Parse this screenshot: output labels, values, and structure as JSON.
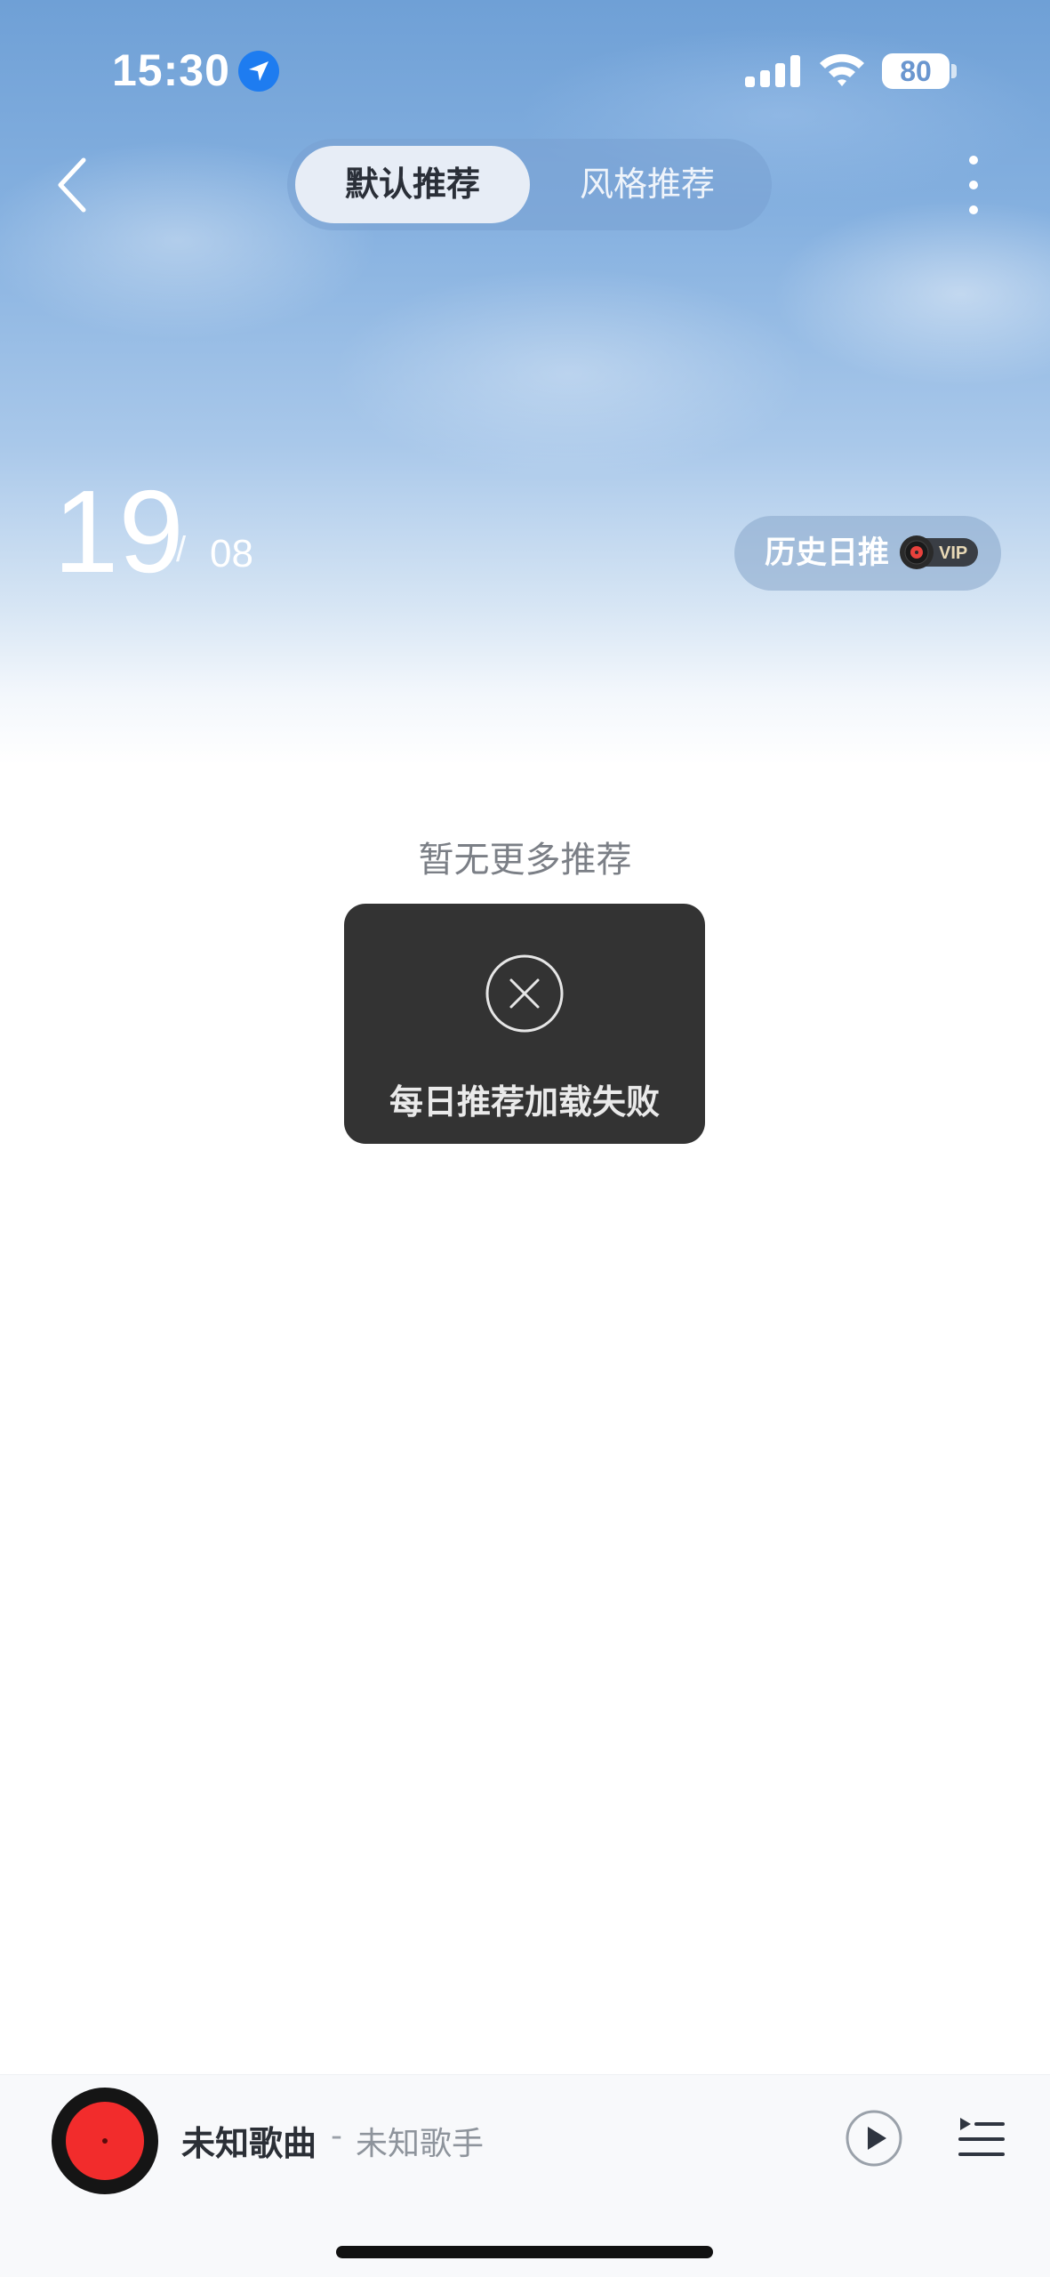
{
  "status_bar": {
    "time": "15:30",
    "battery": "80"
  },
  "nav": {
    "tabs": [
      {
        "label": "默认推荐",
        "active": true
      },
      {
        "label": "风格推荐",
        "active": false
      }
    ]
  },
  "date": {
    "day": "19",
    "separator": "/",
    "month": "08"
  },
  "history": {
    "label": "历史日推",
    "badge": "VIP"
  },
  "empty_state": {
    "message": "暂无更多推荐"
  },
  "toast": {
    "message": "每日推荐加载失败",
    "icon": "close-circle-icon"
  },
  "player": {
    "song": "未知歌曲",
    "separator": "-",
    "artist": "未知歌手"
  },
  "colors": {
    "sky_top": "#6fa0d6",
    "toast_bg": "#333333",
    "disc_label": "#f22c2c",
    "location_badge": "#1e7cf0"
  }
}
